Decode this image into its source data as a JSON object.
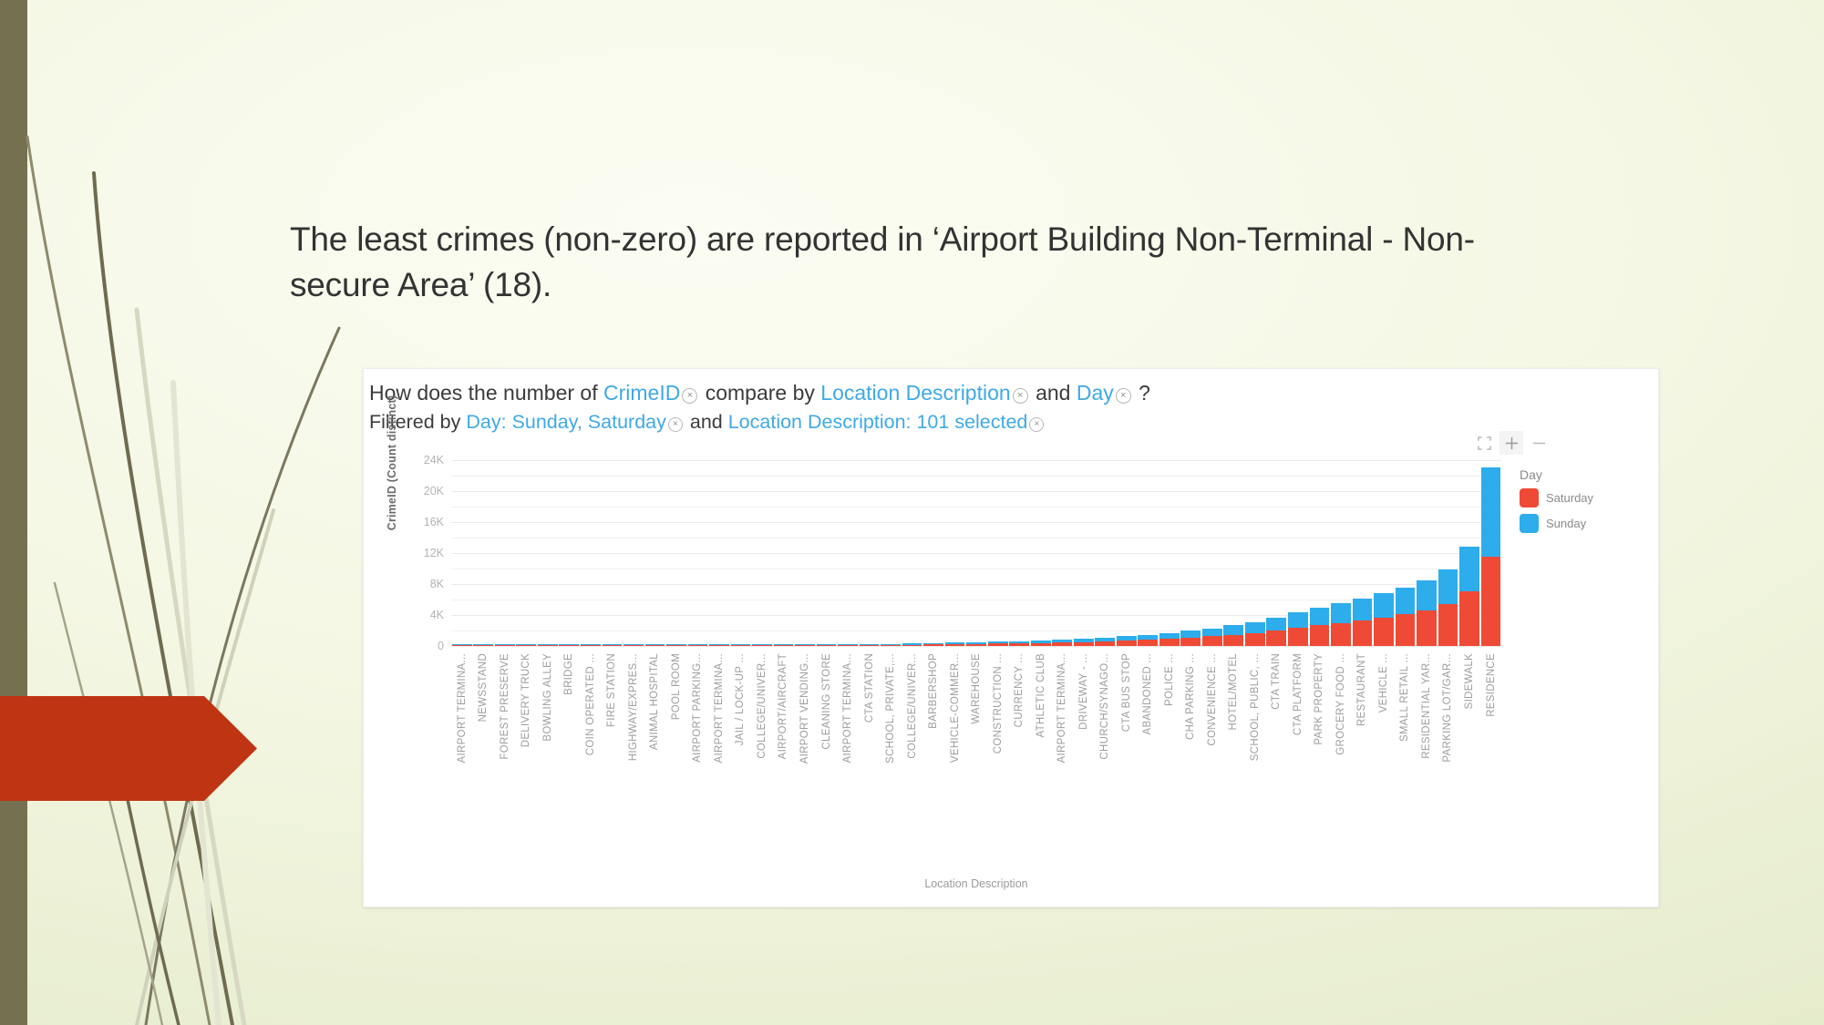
{
  "slide": {
    "body_text": "The least crimes (non-zero) are reported in ‘Airport Building Non-Terminal - Non-secure Area’ (18)."
  },
  "chart_panel": {
    "question": {
      "prefix": "How does the number of",
      "measure": "CrimeID",
      "mid": "compare by",
      "dim1": "Location Description",
      "conj": "and",
      "dim2": "Day",
      "suffix": "?",
      "remove_icon": "×"
    },
    "filters": {
      "prefix": "Filtered by",
      "filter1": "Day: Sunday, Saturday",
      "conj": "and",
      "filter2": "Location Description: 101 selected"
    },
    "toolbar": [
      {
        "name": "fullscreen-icon",
        "label": "Fullscreen"
      },
      {
        "name": "zoom-in-icon",
        "label": "+"
      },
      {
        "name": "zoom-out-icon",
        "label": "−"
      }
    ],
    "legend": {
      "title": "Day",
      "items": [
        {
          "label": "Saturday",
          "color": "#ef4a35"
        },
        {
          "label": "Sunday",
          "color": "#2dadec"
        }
      ]
    }
  },
  "chart_data": {
    "type": "bar",
    "subtype": "stacked",
    "title": "How does the number of CrimeID compare by Location Description and Day?",
    "xlabel": "Location Description",
    "ylabel": "CrimeID (Count distinct)",
    "ylim": [
      0,
      25000
    ],
    "yticks": [
      0,
      4000,
      8000,
      12000,
      16000,
      20000,
      24000
    ],
    "ytick_labels": [
      "0",
      "4K",
      "8K",
      "12K",
      "16K",
      "20K",
      "24K"
    ],
    "grid": true,
    "legend_position": "right",
    "categories": [
      "AIRPORT TERMINA...",
      "NEWSSTAND",
      "FOREST PRESERVE",
      "DELIVERY TRUCK",
      "BOWLING ALLEY",
      "BRIDGE",
      "COIN OPERATED ...",
      "FIRE STATION",
      "HIGHWAY/EXPRES...",
      "ANIMAL HOSPITAL",
      "POOL ROOM",
      "AIRPORT PARKING...",
      "AIRPORT TERMINA...",
      "JAIL / LOCK-UP ...",
      "COLLEGE/UNIVER...",
      "AIRPORT/AIRCRAFT",
      "AIRPORT VENDING...",
      "CLEANING STORE",
      "AIRPORT TERMINA...",
      "CTA STATION",
      "SCHOOL, PRIVATE,...",
      "COLLEGE/UNIVER...",
      "BARBERSHOP",
      "VEHICLE-COMMER...",
      "WAREHOUSE",
      "CONSTRUCTION ...",
      "CURRENCY ...",
      "ATHLETIC CLUB",
      "AIRPORT TERMINA...",
      "DRIVEWAY - ...",
      "CHURCH/SYNAGO...",
      "CTA BUS STOP",
      "ABANDONED ...",
      "POLICE ...",
      "CHA PARKING ...",
      "CONVENIENCE ...",
      "HOTEL/MOTEL",
      "SCHOOL, PUBLIC, ...",
      "CTA TRAIN",
      "CTA PLATFORM",
      "PARK PROPERTY",
      "GROCERY FOOD ...",
      "RESTAURANT",
      "VEHICLE ...",
      "SMALL RETAIL ...",
      "RESIDENTIAL YAR...",
      "PARKING LOT/GAR...",
      "SIDEWALK",
      "RESIDENCE"
    ],
    "series": [
      {
        "name": "Saturday",
        "color": "#ef4a35",
        "values": [
          10,
          12,
          14,
          16,
          18,
          20,
          24,
          26,
          30,
          34,
          38,
          44,
          50,
          58,
          66,
          76,
          88,
          100,
          115,
          132,
          150,
          170,
          195,
          225,
          260,
          300,
          345,
          395,
          455,
          520,
          600,
          690,
          800,
          930,
          1080,
          1250,
          1450,
          1700,
          2000,
          2350,
          2700,
          3000,
          3350,
          3700,
          4100,
          4600,
          5400,
          7100,
          11500
        ]
      },
      {
        "name": "Sunday",
        "color": "#2dadec",
        "values": [
          8,
          10,
          12,
          13,
          15,
          17,
          20,
          22,
          25,
          28,
          32,
          37,
          42,
          48,
          55,
          63,
          72,
          83,
          95,
          110,
          126,
          144,
          165,
          190,
          218,
          250,
          288,
          330,
          380,
          436,
          500,
          575,
          665,
          775,
          900,
          1040,
          1210,
          1420,
          1670,
          1960,
          2250,
          2500,
          2800,
          3100,
          3450,
          3900,
          4500,
          5700,
          11600
        ]
      }
    ],
    "totals_note": "Stacked totals: RESIDENCE ≈ 23.1K, SIDEWALK ≈ 12.8K, PARKING LOT/GARAGE ≈ 9.9K, RESIDENTIAL YARD ≈ 8.5K"
  }
}
